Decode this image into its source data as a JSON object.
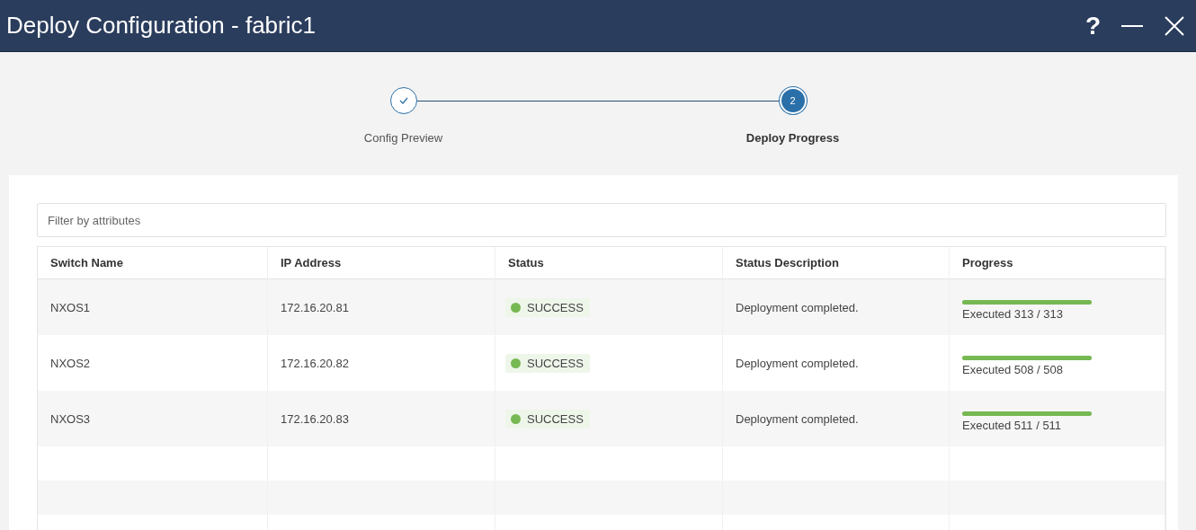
{
  "window": {
    "title": "Deploy Configuration - fabric1",
    "controls": [
      {
        "kind": "help",
        "label": "?"
      },
      {
        "kind": "minimize"
      },
      {
        "kind": "close"
      }
    ]
  },
  "steps": [
    {
      "label": "Config Preview",
      "completed": true
    },
    {
      "label": "Deploy Progress",
      "completed": false,
      "number": "2"
    }
  ],
  "filter": {
    "placeholder": "Filter by attributes"
  },
  "table": {
    "columns": [
      "Switch Name",
      "IP Address",
      "Status",
      "Status Description",
      "Progress"
    ],
    "rows": [
      {
        "name": "NXOS1",
        "ip": "172.16.20.81",
        "status": {
          "kind": "success",
          "text": "SUCCESS"
        },
        "description": "Deployment completed.",
        "progress": {
          "level": 1,
          "text": "Executed 313 / 313"
        }
      },
      {
        "name": "NXOS2",
        "ip": "172.16.20.82",
        "status": {
          "kind": "success",
          "text": "SUCCESS"
        },
        "description": "Deployment completed.",
        "progress": {
          "level": 1,
          "text": "Executed 508 / 508"
        }
      },
      {
        "name": "NXOS3",
        "ip": "172.16.20.83",
        "status": {
          "kind": "success",
          "text": "SUCCESS"
        },
        "description": "Deployment completed.",
        "progress": {
          "level": 1,
          "text": "Executed 511 / 511"
        }
      }
    ]
  }
}
